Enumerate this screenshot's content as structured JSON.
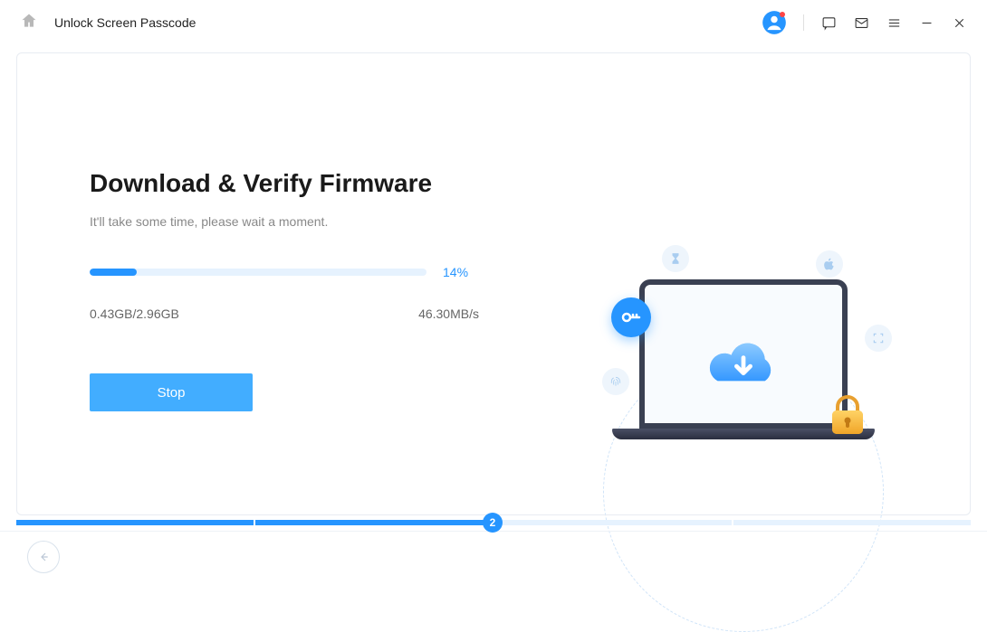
{
  "header": {
    "title": "Unlock Screen Passcode"
  },
  "main": {
    "heading": "Download & Verify Firmware",
    "subheading": "It'll take some time, please wait a moment.",
    "progress": {
      "percent": 14,
      "percent_label": "14%",
      "fill_width": "14%"
    },
    "stats": {
      "size": "0.43GB/2.96GB",
      "speed": "46.30MB/s"
    },
    "stop_label": "Stop"
  },
  "steps": {
    "current": 2,
    "current_label": "2",
    "total": 4
  },
  "colors": {
    "accent": "#2695ff",
    "accent_light": "#42adff",
    "track": "#e6f2fe"
  }
}
